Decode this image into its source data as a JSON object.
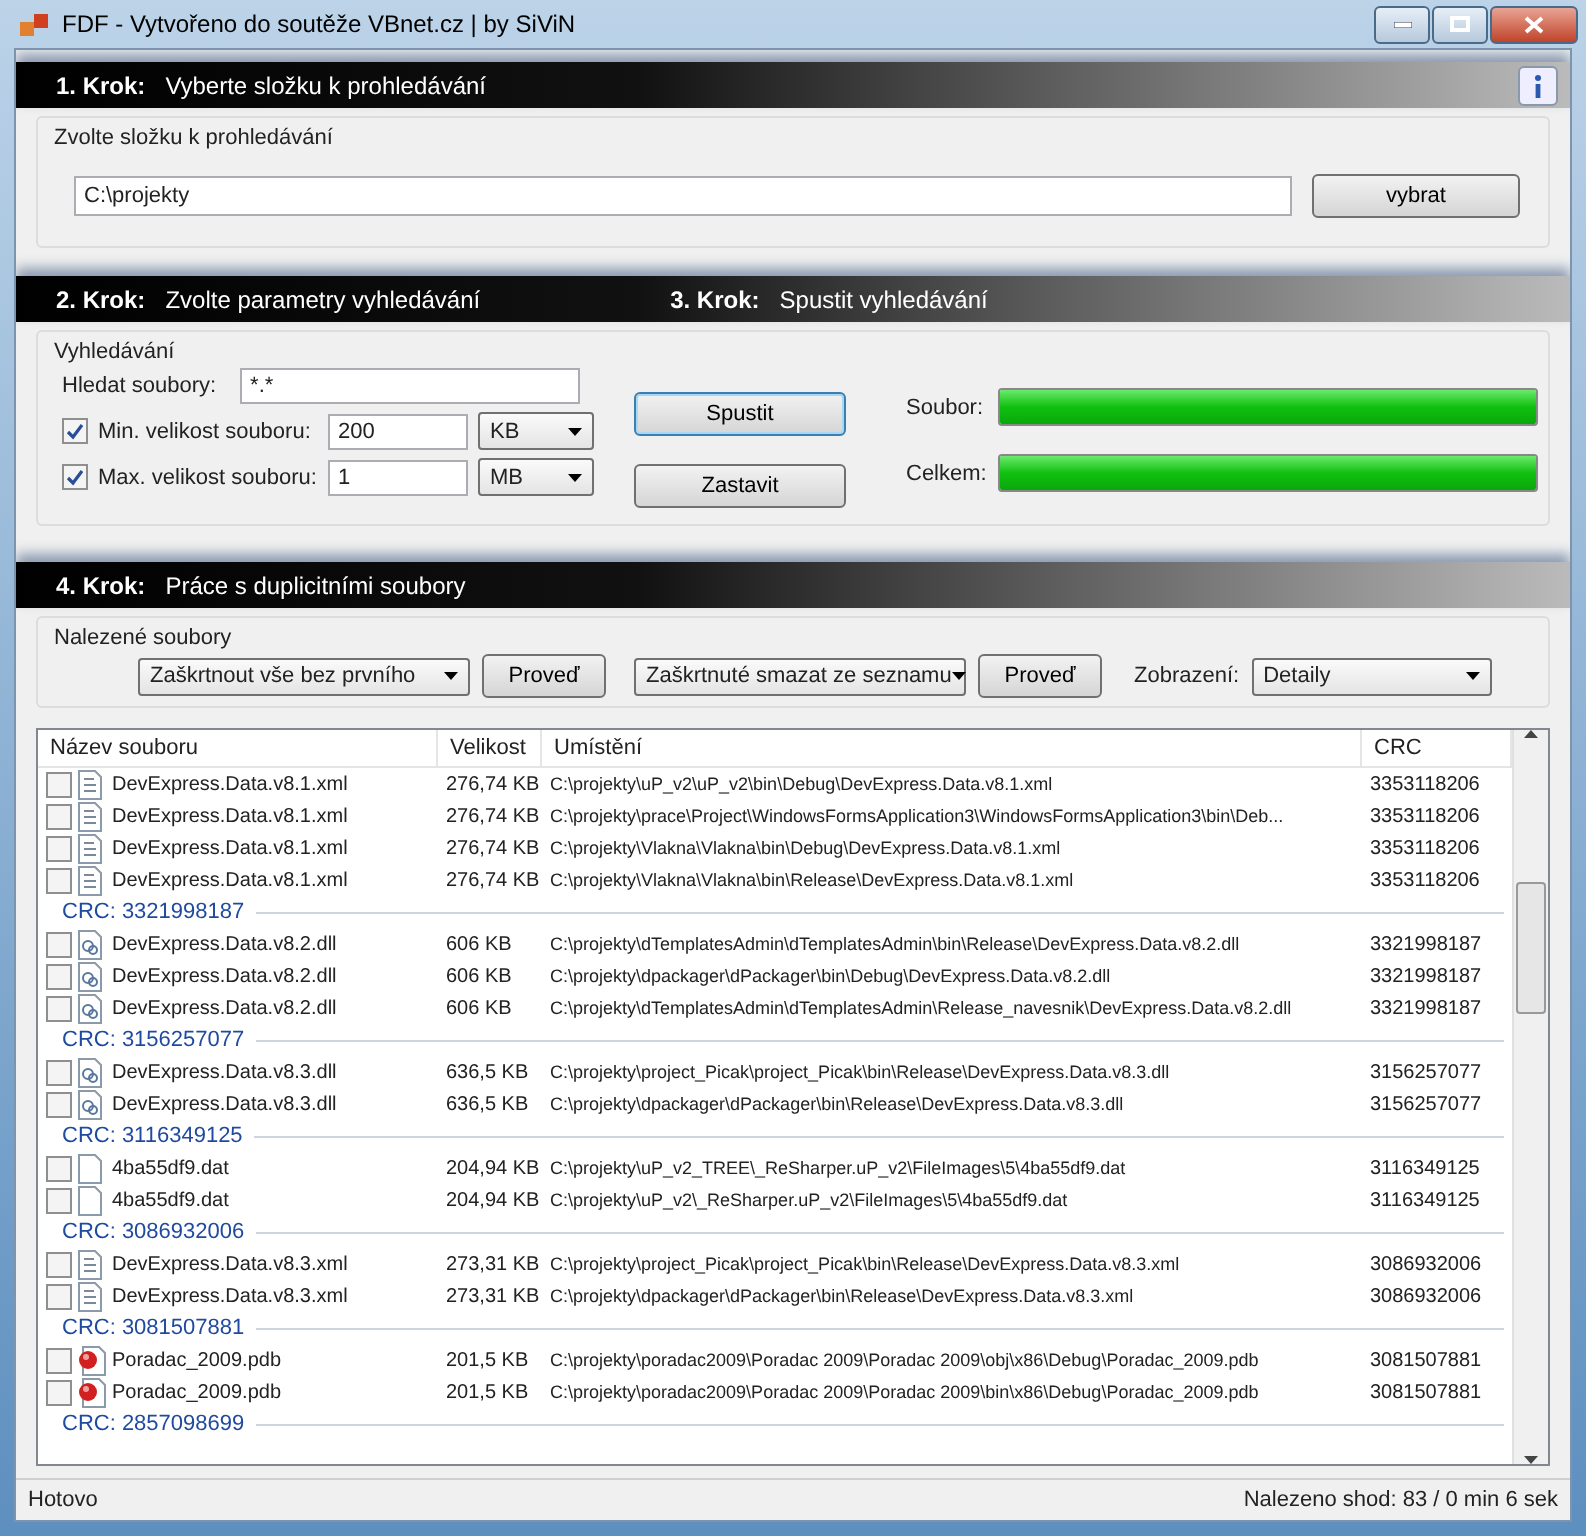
{
  "window": {
    "title": "FDF - Vytvořeno do soutěže VBnet.cz | by SiViN"
  },
  "step1": {
    "label": "1. Krok:",
    "text": "Vyberte složku k prohledávání"
  },
  "folder_group": {
    "title": "Zvolte složku k prohledávání",
    "path": "C:\\projekty",
    "button": "vybrat"
  },
  "step2": {
    "label": "2. Krok:",
    "text": "Zvolte parametry vyhledávání"
  },
  "step3": {
    "label": "3. Krok:",
    "text": "Spustit vyhledávání"
  },
  "search_group": {
    "title": "Vyhledávání",
    "pattern_label": "Hledat soubory:",
    "pattern": "*.*",
    "min": {
      "label": "Min. velikost souboru:",
      "checked": true,
      "value": "200",
      "unit": "KB"
    },
    "max": {
      "label": "Max. velikost souboru:",
      "checked": true,
      "value": "1",
      "unit": "MB"
    },
    "start_button": "Spustit",
    "stop_button": "Zastavit",
    "progress": [
      {
        "label": "Soubor:",
        "level": 1
      },
      {
        "label": "Celkem:",
        "level": 1
      }
    ]
  },
  "step4": {
    "label": "4. Krok:",
    "text": "Práce s duplicitními soubory"
  },
  "found_group": {
    "title": "Nalezené soubory",
    "select_action": "Zaškrtnout vše bez prvního",
    "run1": "Proveď",
    "delete_action": "Zaškrtnuté smazat ze seznamu",
    "run2": "Proveď",
    "view_label": "Zobrazení:",
    "view": "Detaily"
  },
  "table": {
    "columns": [
      "Název souboru",
      "Velikost",
      "Umístění",
      "CRC"
    ],
    "groups": [
      {
        "rows": [
          {
            "kind": "xml",
            "checked": false,
            "name": "DevExpress.Data.v8.1.xml",
            "size": "276,74 KB",
            "path": "C:\\projekty\\uP_v2\\uP_v2\\bin\\Debug\\DevExpress.Data.v8.1.xml",
            "crc": "3353118206"
          },
          {
            "kind": "xml",
            "checked": false,
            "name": "DevExpress.Data.v8.1.xml",
            "size": "276,74 KB",
            "path": "C:\\projekty\\prace\\Project\\WindowsFormsApplication3\\WindowsFormsApplication3\\bin\\Deb...",
            "crc": "3353118206"
          },
          {
            "kind": "xml",
            "checked": false,
            "name": "DevExpress.Data.v8.1.xml",
            "size": "276,74 KB",
            "path": "C:\\projekty\\Vlakna\\Vlakna\\bin\\Debug\\DevExpress.Data.v8.1.xml",
            "crc": "3353118206"
          },
          {
            "kind": "xml",
            "checked": false,
            "name": "DevExpress.Data.v8.1.xml",
            "size": "276,74 KB",
            "path": "C:\\projekty\\Vlakna\\Vlakna\\bin\\Release\\DevExpress.Data.v8.1.xml",
            "crc": "3353118206"
          }
        ]
      },
      {
        "header": "CRC: 3321998187",
        "rows": [
          {
            "kind": "dll",
            "checked": false,
            "name": "DevExpress.Data.v8.2.dll",
            "size": "606 KB",
            "path": "C:\\projekty\\dTemplatesAdmin\\dTemplatesAdmin\\bin\\Release\\DevExpress.Data.v8.2.dll",
            "crc": "3321998187"
          },
          {
            "kind": "dll",
            "checked": false,
            "name": "DevExpress.Data.v8.2.dll",
            "size": "606 KB",
            "path": "C:\\projekty\\dpackager\\dPackager\\bin\\Debug\\DevExpress.Data.v8.2.dll",
            "crc": "3321998187"
          },
          {
            "kind": "dll",
            "checked": false,
            "name": "DevExpress.Data.v8.2.dll",
            "size": "606 KB",
            "path": "C:\\projekty\\dTemplatesAdmin\\dTemplatesAdmin\\Release_navesnik\\DevExpress.Data.v8.2.dll",
            "crc": "3321998187"
          }
        ]
      },
      {
        "header": "CRC: 3156257077",
        "rows": [
          {
            "kind": "dll",
            "checked": false,
            "name": "DevExpress.Data.v8.3.dll",
            "size": "636,5 KB",
            "path": "C:\\projekty\\project_Picak\\project_Picak\\bin\\Release\\DevExpress.Data.v8.3.dll",
            "crc": "3156257077"
          },
          {
            "kind": "dll",
            "checked": false,
            "name": "DevExpress.Data.v8.3.dll",
            "size": "636,5 KB",
            "path": "C:\\projekty\\dpackager\\dPackager\\bin\\Release\\DevExpress.Data.v8.3.dll",
            "crc": "3156257077"
          }
        ]
      },
      {
        "header": "CRC: 3116349125",
        "rows": [
          {
            "kind": "dat",
            "checked": false,
            "name": "4ba55df9.dat",
            "size": "204,94 KB",
            "path": "C:\\projekty\\uP_v2_TREE\\_ReSharper.uP_v2\\FileImages\\5\\4ba55df9.dat",
            "crc": "3116349125"
          },
          {
            "kind": "dat",
            "checked": false,
            "name": "4ba55df9.dat",
            "size": "204,94 KB",
            "path": "C:\\projekty\\uP_v2\\_ReSharper.uP_v2\\FileImages\\5\\4ba55df9.dat",
            "crc": "3116349125"
          }
        ]
      },
      {
        "header": "CRC: 3086932006",
        "rows": [
          {
            "kind": "xml",
            "checked": false,
            "name": "DevExpress.Data.v8.3.xml",
            "size": "273,31 KB",
            "path": "C:\\projekty\\project_Picak\\project_Picak\\bin\\Release\\DevExpress.Data.v8.3.xml",
            "crc": "3086932006"
          },
          {
            "kind": "xml",
            "checked": false,
            "name": "DevExpress.Data.v8.3.xml",
            "size": "273,31 KB",
            "path": "C:\\projekty\\dpackager\\dPackager\\bin\\Release\\DevExpress.Data.v8.3.xml",
            "crc": "3086932006"
          }
        ]
      },
      {
        "header": "CRC: 3081507881",
        "rows": [
          {
            "kind": "pdb",
            "checked": false,
            "name": "Poradac_2009.pdb",
            "size": "201,5 KB",
            "path": "C:\\projekty\\poradac2009\\Poradac 2009\\Poradac 2009\\obj\\x86\\Debug\\Poradac_2009.pdb",
            "crc": "3081507881"
          },
          {
            "kind": "pdb",
            "checked": false,
            "name": "Poradac_2009.pdb",
            "size": "201,5 KB",
            "path": "C:\\projekty\\poradac2009\\Poradac 2009\\Poradac 2009\\bin\\x86\\Debug\\Poradac_2009.pdb",
            "crc": "3081507881"
          }
        ]
      },
      {
        "header": "CRC: 2857098699"
      }
    ]
  },
  "status_bar": {
    "left": "Hotovo",
    "right": "Nalezeno shod: 83 / 0 min 6 sek"
  }
}
